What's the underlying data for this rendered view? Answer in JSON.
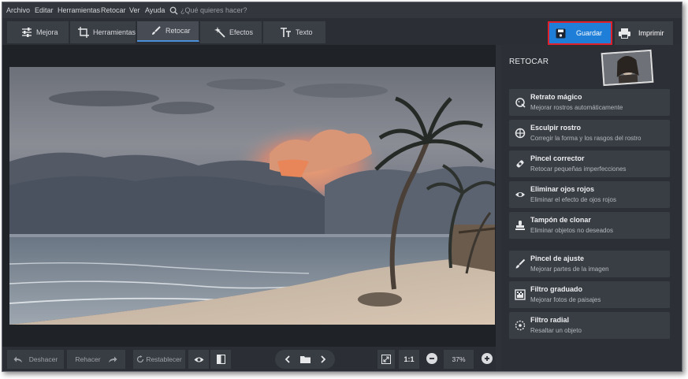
{
  "menu": {
    "items": [
      "Archivo",
      "Editar",
      "Herramientas",
      "Retocar",
      "Ver",
      "Ayuda"
    ],
    "search_placeholder": "¿Qué quieres hacer?"
  },
  "tabs": [
    {
      "label": "Mejora",
      "icon": "sliders-icon"
    },
    {
      "label": "Herramientas",
      "icon": "crop-icon"
    },
    {
      "label": "Retocar",
      "icon": "brush-icon",
      "active": true
    },
    {
      "label": "Efectos",
      "icon": "magic-wand-icon"
    },
    {
      "label": "Texto",
      "icon": "text-icon"
    }
  ],
  "actions": {
    "save_label": "Guardar",
    "print_label": "Imprimir"
  },
  "panel": {
    "title": "RETOCAR",
    "tools": [
      {
        "name": "Retrato mágico",
        "desc": "Mejorar rostros automáticamente",
        "icon": "face-magic-icon"
      },
      {
        "name": "Esculpir rostro",
        "desc": "Corregir la forma y los rasgos del rostro",
        "icon": "face-sculpt-icon"
      },
      {
        "name": "Pincel corrector",
        "desc": "Retocar pequeñas imperfecciones",
        "icon": "bandage-icon"
      },
      {
        "name": "Eliminar ojos rojos",
        "desc": "Eliminar el efecto de ojos rojos",
        "icon": "eye-icon"
      },
      {
        "name": "Tampón de clonar",
        "desc": "Eliminar objetos no deseados",
        "icon": "stamp-icon"
      },
      {
        "name": "Pincel de ajuste",
        "desc": "Mejorar partes de la imagen",
        "icon": "adjust-brush-icon"
      },
      {
        "name": "Filtro graduado",
        "desc": "Mejorar fotos de paisajes",
        "icon": "gradient-filter-icon"
      },
      {
        "name": "Filtro radial",
        "desc": "Resaltar un objeto",
        "icon": "radial-filter-icon"
      }
    ]
  },
  "bottom": {
    "undo_label": "Deshacer",
    "redo_label": "Rehacer",
    "reset_label": "Restablecer",
    "ratio_label": "1:1",
    "zoom_value": "37%"
  },
  "colors": {
    "accent": "#1f7ed8",
    "highlight_border": "#e0202a",
    "bg": "#2e3238"
  }
}
